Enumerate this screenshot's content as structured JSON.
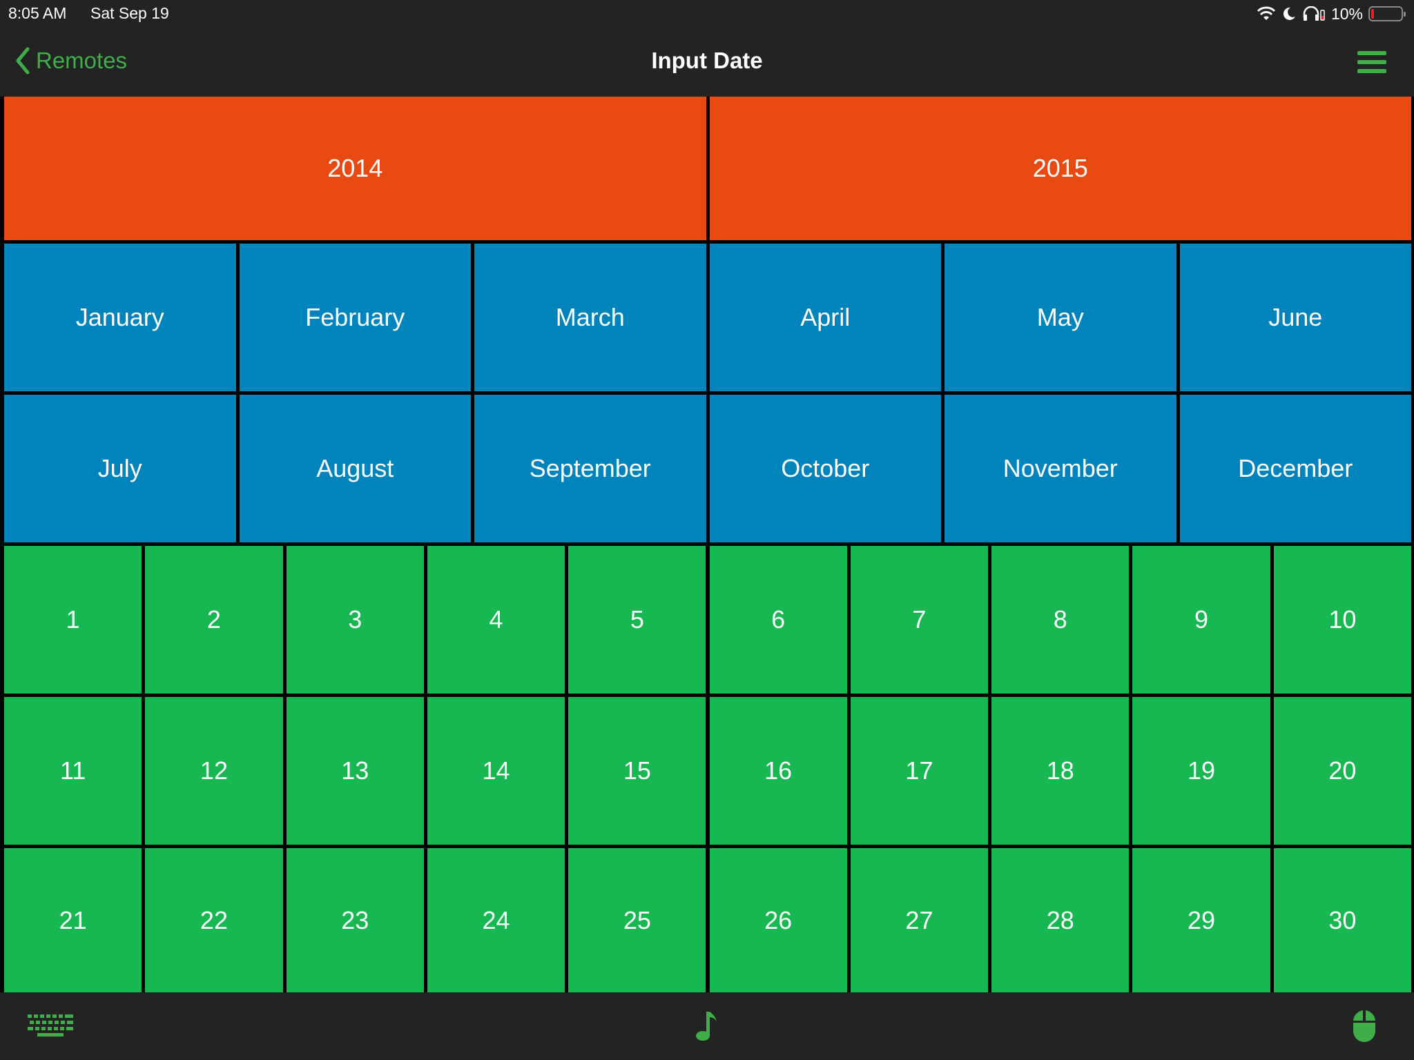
{
  "status_bar": {
    "time": "8:05 AM",
    "date": "Sat Sep 19",
    "battery": "10%",
    "battery_level": 0.1,
    "icons": [
      "wifi-icon",
      "moon-icon",
      "headphones-icon",
      "battery-icon"
    ]
  },
  "nav": {
    "back_label": "Remotes",
    "title": "Input Date",
    "menu_icon": "hamburger-menu-icon"
  },
  "colors": {
    "year": "#e84a12",
    "month": "#0183bb",
    "day": "#17b751",
    "accent": "#3fae49",
    "bar": "#232323"
  },
  "years": [
    "2014",
    "2015"
  ],
  "months": [
    "January",
    "February",
    "March",
    "April",
    "May",
    "June",
    "July",
    "August",
    "September",
    "October",
    "November",
    "December"
  ],
  "days": [
    "1",
    "2",
    "3",
    "4",
    "5",
    "6",
    "7",
    "8",
    "9",
    "10",
    "11",
    "12",
    "13",
    "14",
    "15",
    "16",
    "17",
    "18",
    "19",
    "20",
    "21",
    "22",
    "23",
    "24",
    "25",
    "26",
    "27",
    "28",
    "29",
    "30"
  ],
  "bottom_bar": {
    "left_icon": "keyboard-icon",
    "center_icon": "music-note-icon",
    "right_icon": "mouse-icon"
  }
}
